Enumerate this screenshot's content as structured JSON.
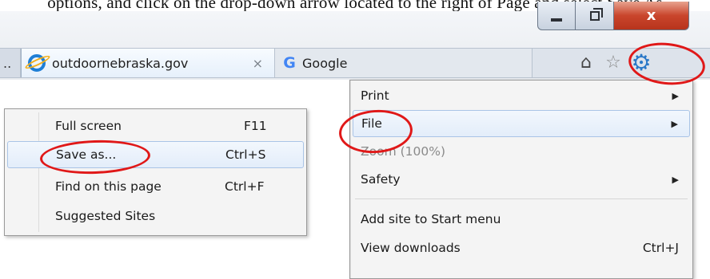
{
  "top_text": "options, and click on the drop-down arrow located to the right of Page and select Save As",
  "window": {
    "minimize_glyph": "minimize",
    "maximize_glyph": "maximize",
    "close_glyph": "x"
  },
  "tabs": {
    "prev_overflow": "..",
    "active": {
      "icon": "ie-icon",
      "label": "outdoornebraska.gov",
      "close": "×"
    },
    "inactive": {
      "icon": "google-g-icon",
      "icon_text": "G",
      "label": "Google"
    }
  },
  "toolbar": {
    "home_icon": "⌂",
    "favorites_icon": "☆",
    "tools_icon": "⚙"
  },
  "main_menu": {
    "items": [
      {
        "label": "Print",
        "has_submenu": true
      },
      {
        "label": "File",
        "has_submenu": true,
        "highlighted": true
      },
      {
        "label": "Zoom (100%)",
        "disabled": true
      },
      {
        "label": "Safety",
        "has_submenu": true
      },
      {
        "label": "Add site to Start menu"
      },
      {
        "label": "View downloads",
        "shortcut": "Ctrl+J"
      }
    ],
    "arrow": "▶"
  },
  "file_submenu": {
    "items": [
      {
        "label": "Full screen",
        "shortcut": "F11"
      },
      {
        "label": "Save as...",
        "shortcut": "Ctrl+S",
        "highlighted": true
      },
      {
        "label": "Find on this page",
        "shortcut": "Ctrl+F"
      },
      {
        "label": "Suggested Sites",
        "shortcut": ""
      }
    ]
  },
  "colors": {
    "annotation_red": "#e01818",
    "highlight_border": "#a9c4e6",
    "close_button": "#c9452c",
    "gear_blue": "#2a78c7"
  }
}
